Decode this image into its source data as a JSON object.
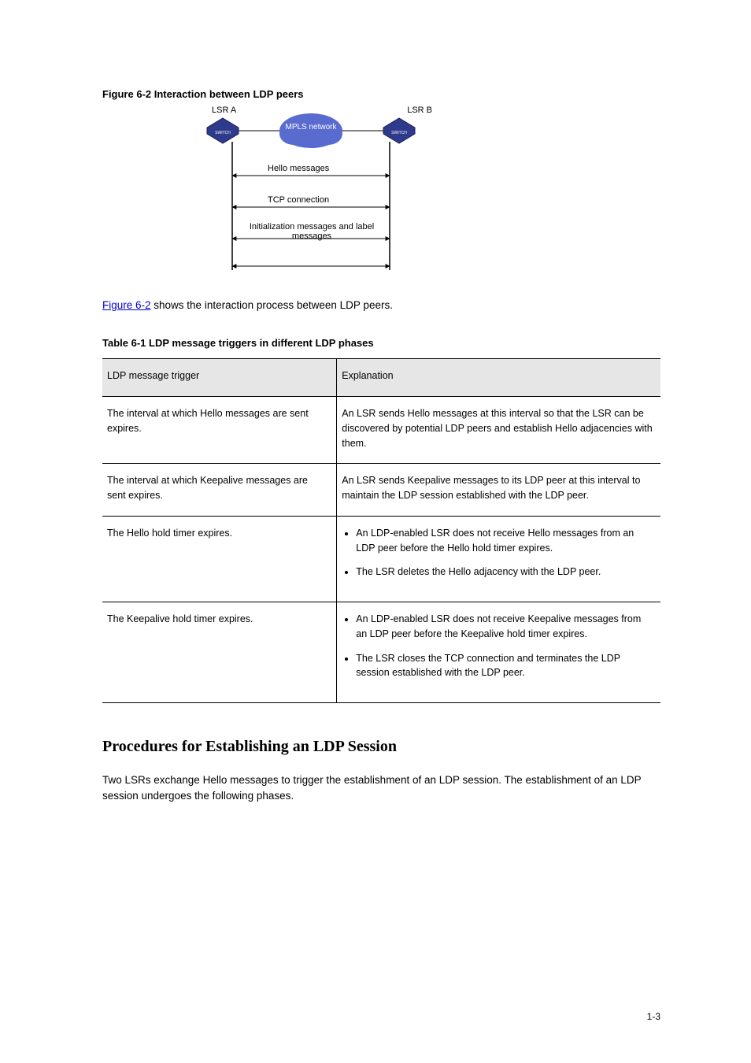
{
  "figure": {
    "label": "Figure 6-2",
    "title": "Interaction between LDP peers",
    "left_node": "LSR A",
    "right_node": "LSR B",
    "cloud": "MPLS network",
    "msg1": "Hello messages",
    "msg2": "TCP connection",
    "msg3": "Initialization messages and label messages"
  },
  "caption": {
    "link_text": "Figure 6-2",
    "rest": " shows the interaction process between LDP peers."
  },
  "table": {
    "label": "Table 6-1",
    "title": "LDP message triggers in different LDP phases",
    "head_col1": "LDP message trigger",
    "head_col2": "Explanation",
    "rows": [
      {
        "trigger": "The interval at which Hello messages are sent expires.",
        "explain_type": "plain",
        "explain": "An LSR sends Hello messages at this interval so that the LSR can be discovered by potential LDP peers and establish Hello adjacencies with them."
      },
      {
        "trigger": "The interval at which Keepalive messages are sent expires.",
        "explain_type": "plain",
        "explain": "An LSR sends Keepalive messages to its LDP peer at this interval to maintain the LDP session established with the LDP peer."
      },
      {
        "trigger": "The Hello hold timer expires.",
        "explain_type": "bullets",
        "bullets": [
          "An LDP-enabled LSR does not receive Hello messages from an LDP peer before the Hello hold timer expires.",
          "The LSR deletes the Hello adjacency with the LDP peer."
        ]
      },
      {
        "trigger": "The Keepalive hold timer expires.",
        "explain_type": "bullets",
        "bullets": [
          "An LDP-enabled LSR does not receive Keepalive messages from an LDP peer before the Keepalive hold timer expires.",
          "The LSR closes the TCP connection and terminates the LDP session established with the LDP peer."
        ]
      }
    ]
  },
  "section": {
    "heading": "Procedures for Establishing an LDP Session",
    "body": "Two LSRs exchange Hello messages to trigger the establishment of an LDP session. The establishment of an LDP session undergoes the following phases."
  },
  "footer": "1-3"
}
